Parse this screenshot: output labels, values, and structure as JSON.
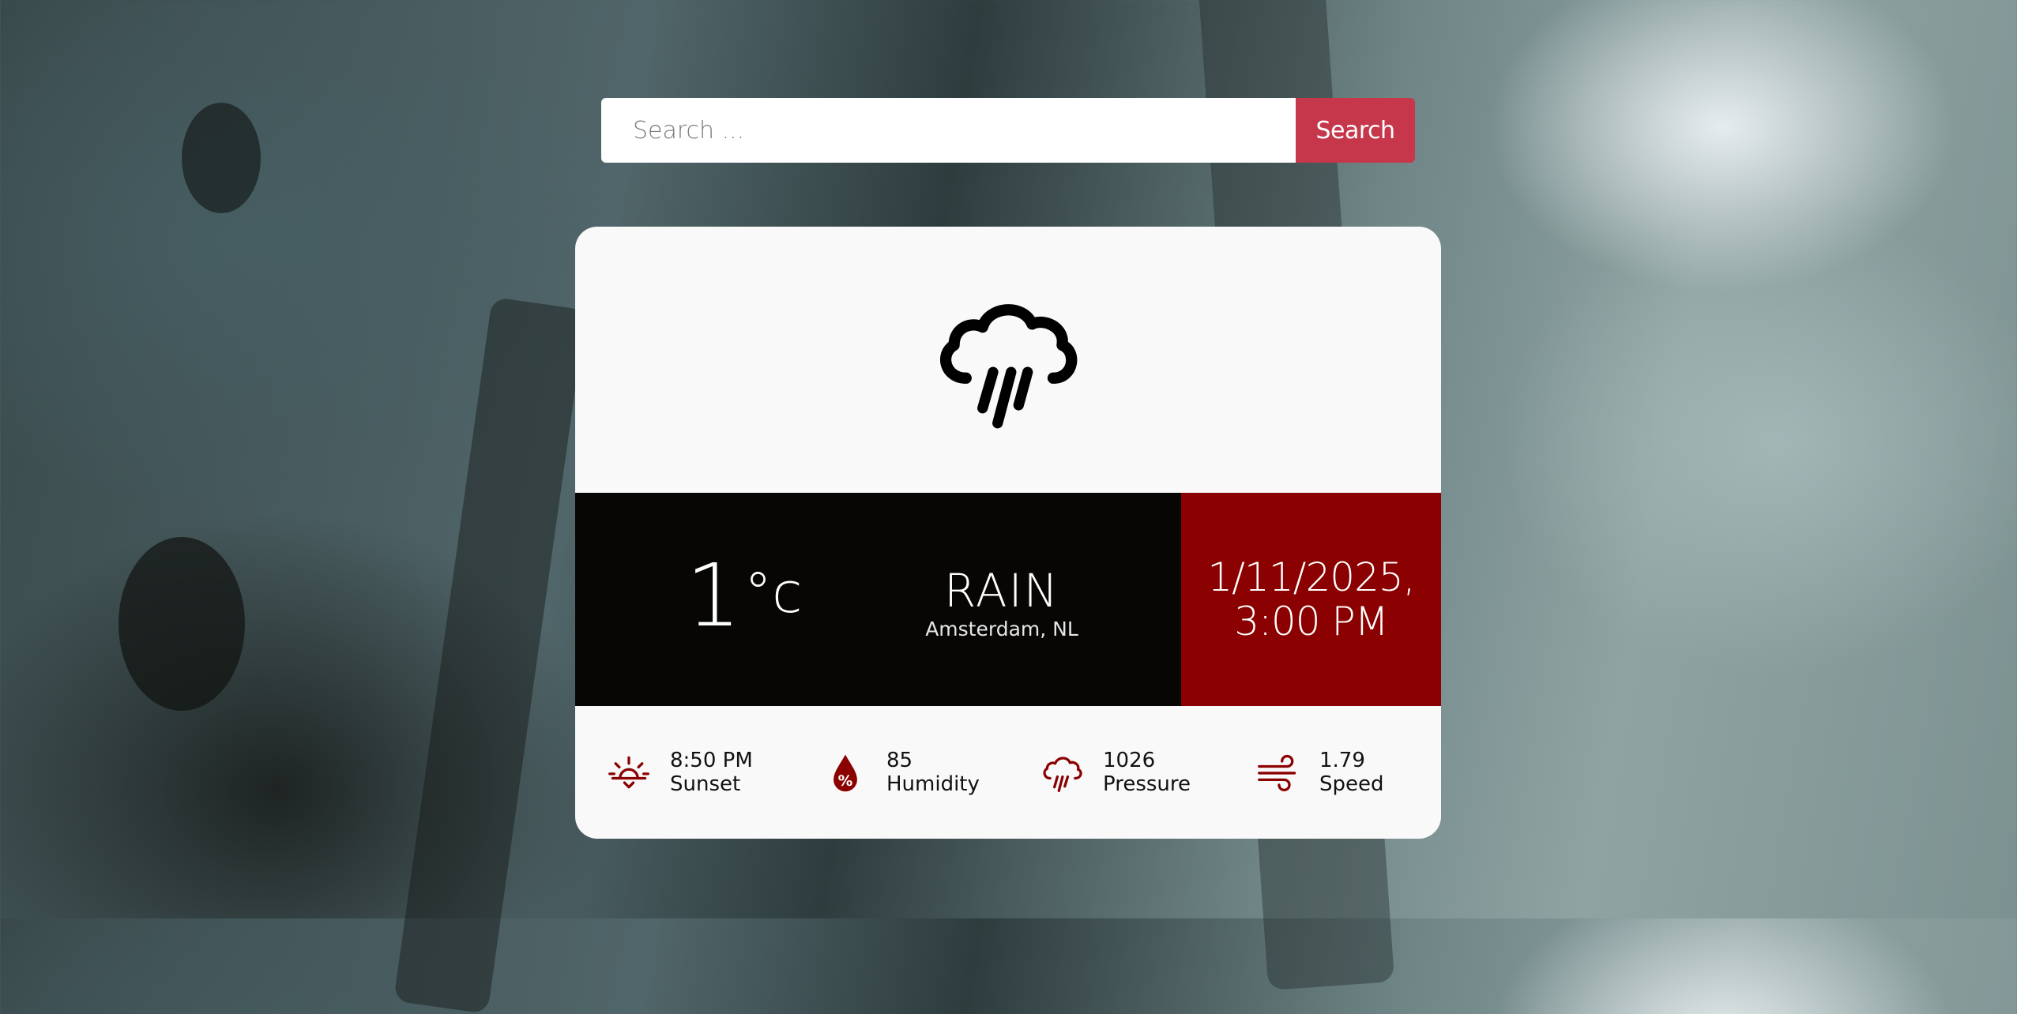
{
  "search": {
    "placeholder": "Search ...",
    "button_label": "Search"
  },
  "weather": {
    "icon": "cloud-rain-icon",
    "temperature": "1",
    "temperature_unit": "°c",
    "condition": "RAIN",
    "location": "Amsterdam, NL",
    "date_line1": "1/11/2025,",
    "date_line2": "3:00 PM"
  },
  "stats": [
    {
      "icon": "sunset-icon",
      "value": "8:50 PM",
      "label": "Sunset"
    },
    {
      "icon": "humidity-drop-icon",
      "value": "85",
      "label": "Humidity"
    },
    {
      "icon": "pressure-cloud-icon",
      "value": "1026",
      "label": "Pressure"
    },
    {
      "icon": "wind-icon",
      "value": "1.79",
      "label": "Speed"
    }
  ],
  "colors": {
    "accent": "#c6374c",
    "date_panel": "#8b0000",
    "dark_band": "#070605",
    "card": "#f9f9f9"
  }
}
